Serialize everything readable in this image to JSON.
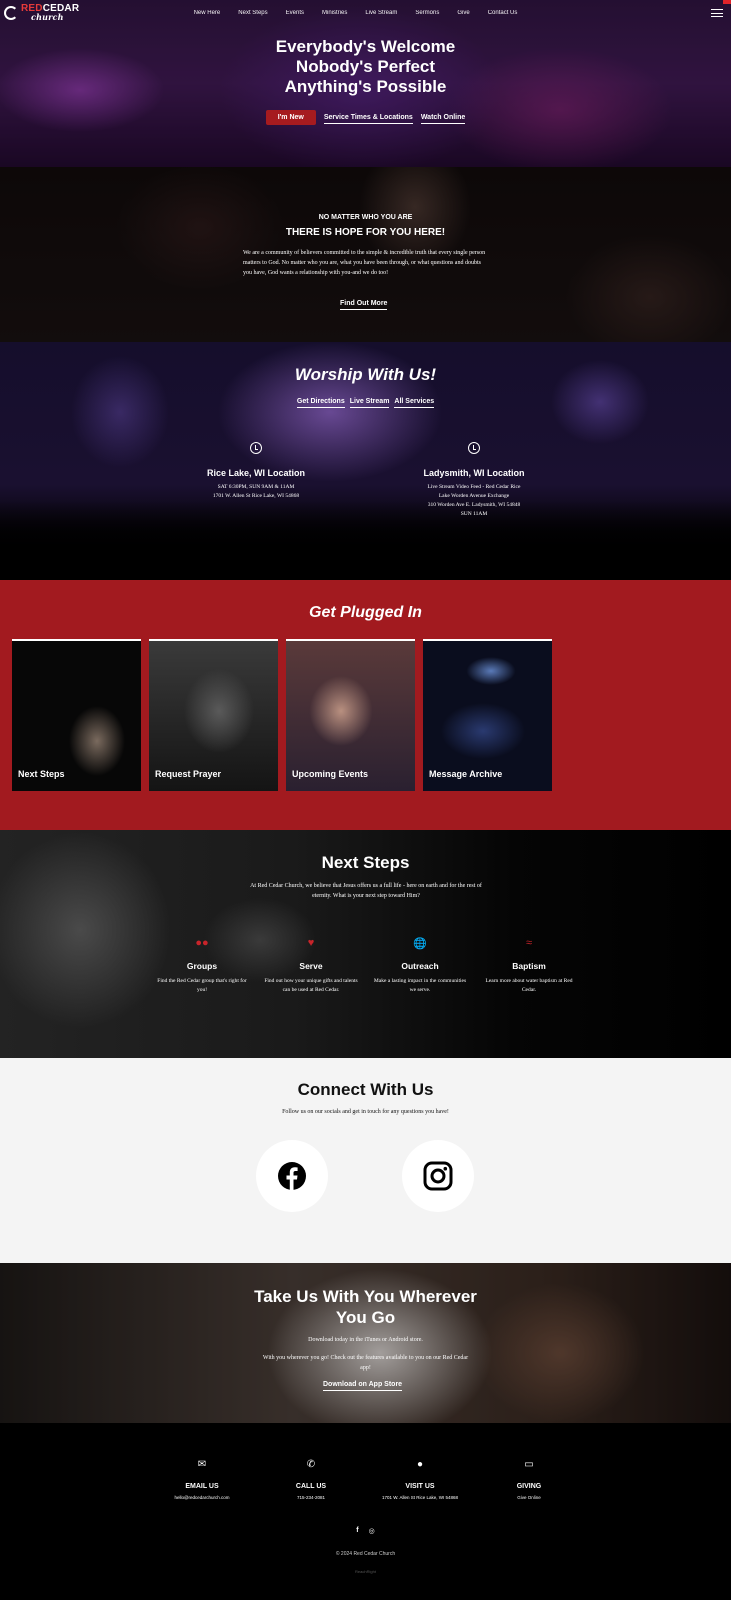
{
  "brand": {
    "name_red": "RED",
    "name_rest": "CEDAR",
    "sub": "church"
  },
  "nav": [
    "New Here",
    "Next Steps",
    "Events",
    "Ministries",
    "Live Stream",
    "Sermons",
    "Give",
    "Contact Us"
  ],
  "hero": {
    "lines": [
      "Everybody's Welcome",
      "Nobody's Perfect",
      "Anything's Possible"
    ],
    "btn_new": "I'm New",
    "btn_times": "Service Times & Locations",
    "btn_watch": "Watch Online"
  },
  "hope": {
    "kicker": "NO MATTER WHO YOU ARE",
    "title": "THERE IS HOPE FOR YOU HERE!",
    "body": "We are a community of believers committed to the simple & incredible truth that every single person matters to God. No matter who you are, what you have been through, or what questions and doubts you have, God wants a relationship with you-and we do too!",
    "btn": "Find Out More"
  },
  "worship": {
    "title": "Worship With Us!",
    "links": [
      "Get Directions",
      "Live Stream",
      "All Services"
    ],
    "loc1": {
      "name": "Rice Lake, WI Location",
      "line1": "SAT 6:30PM, SUN 9AM & 11AM",
      "line2": "1701 W. Allen St Rice Lake, WI 54868"
    },
    "loc2": {
      "name": "Ladysmith, WI Location",
      "line1": "Live Stream Video Feed - Red Cedar Rice",
      "line2": "Lake Worden Avenue Exchange",
      "line3": "310 Worden Ave E. Ladysmith, WI 54848",
      "line4": "SUN 11AM"
    }
  },
  "plugged": {
    "title": "Get Plugged In",
    "cards": [
      "Next Steps",
      "Request Prayer",
      "Upcoming Events",
      "Message Archive"
    ]
  },
  "steps": {
    "title": "Next Steps",
    "intro": "At Red Cedar Church, we believe that Jesus offers us a full life - here on earth and for the rest of eternity. What is your next step toward Him?",
    "items": [
      {
        "title": "Groups",
        "desc": "Find the Red Cedar group that's right for you!"
      },
      {
        "title": "Serve",
        "desc": "Find out how your unique gifts and talents can be used at Red Cedar."
      },
      {
        "title": "Outreach",
        "desc": "Make a lasting impact in the communities we serve."
      },
      {
        "title": "Baptism",
        "desc": "Learn more about water baptism at Red Cedar."
      }
    ]
  },
  "connect": {
    "title": "Connect With Us",
    "subtitle": "Follow us on our socials and get in touch for any questions you have!"
  },
  "app": {
    "title_1": "Take Us With You Wherever",
    "title_2": "You Go",
    "line1": "Download today in the iTunes or Android store.",
    "line2": "With you wherever you go! Check out the features available to you on our Red Cedar",
    "line3": "app!",
    "btn": "Download on App Store"
  },
  "footer": {
    "items": [
      {
        "label": "EMAIL US",
        "value": "hello@redcedarchurch.com"
      },
      {
        "label": "CALL US",
        "value": "715-234-2081"
      },
      {
        "label": "VISIT US",
        "value": "1701 W. Allen St Rice Lake, WI 54868"
      },
      {
        "label": "GIVING",
        "value": "Give Online"
      }
    ],
    "copyright": "© 2024 Red Cedar Church",
    "credit": "ReachRight"
  },
  "colors": {
    "brand_red": "#a21a1f",
    "accent_red": "#c8242a"
  }
}
